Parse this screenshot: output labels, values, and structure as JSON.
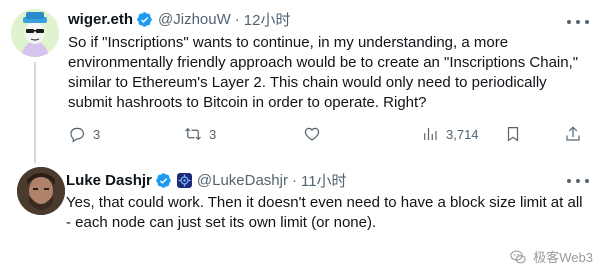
{
  "tweets": [
    {
      "name": "wiger.eth",
      "handle": "@JizhouW",
      "separator": "·",
      "time": "12小时",
      "text": "So if \"Inscriptions\" wants to continue, in my understanding, a more environmentally friendly approach would be to create an \"Inscriptions Chain,\" similar to Ethereum's Layer 2. This chain would only need to periodically submit hashroots to Bitcoin in order to operate. Right?",
      "actions": {
        "replies": "3",
        "reposts": "3",
        "likes": "",
        "views": "3,714"
      }
    },
    {
      "name": "Luke Dashjr",
      "handle": "@LukeDashjr",
      "separator": "·",
      "time": "11小时",
      "text": "Yes, that could work. Then it doesn't even need to have a block size limit at all - each node can just set its own limit (or none)."
    }
  ],
  "watermark": {
    "text": "极客Web3"
  },
  "colors": {
    "verified": "#1d9bf0",
    "secondary_text": "#536471",
    "primary_text": "#0f1419",
    "thread_line": "#cfd9de"
  }
}
